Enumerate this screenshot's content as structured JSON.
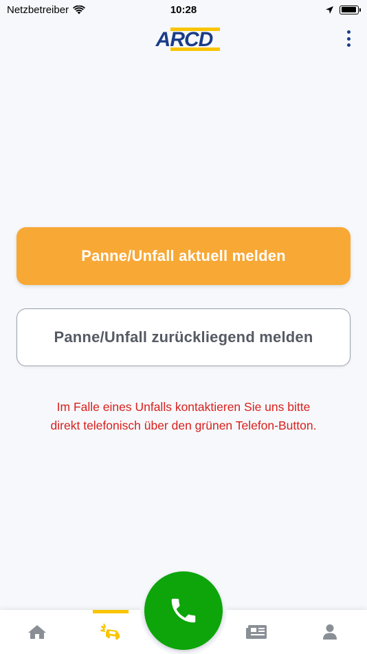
{
  "status_bar": {
    "carrier": "Netzbetreiber",
    "time": "10:28",
    "battery_level": 0.95
  },
  "header": {
    "logo_text": "ARCD",
    "menu_icon": "more-vertical-icon"
  },
  "actions": {
    "report_current_label": "Panne/Unfall aktuell melden",
    "report_past_label": "Panne/Unfall zurückliegend melden"
  },
  "notice": {
    "line1": "Im Falle eines Unfalls kontaktieren Sie uns bitte",
    "line2": "direkt telefonisch über den grünen Telefon-Button."
  },
  "tabbar": {
    "active_tab": "breakdown",
    "tabs": [
      {
        "id": "home",
        "icon": "home-icon"
      },
      {
        "id": "breakdown",
        "icon": "car-crash-icon"
      },
      {
        "id": "call",
        "icon": "phone-icon"
      },
      {
        "id": "news",
        "icon": "newspaper-icon"
      },
      {
        "id": "profile",
        "icon": "person-icon"
      }
    ]
  },
  "colors": {
    "primary_orange": "#f8a835",
    "alert_red": "#d9201d",
    "call_green": "#0da50a",
    "brand_blue": "#1b3c87",
    "brand_yellow": "#f9c400"
  }
}
